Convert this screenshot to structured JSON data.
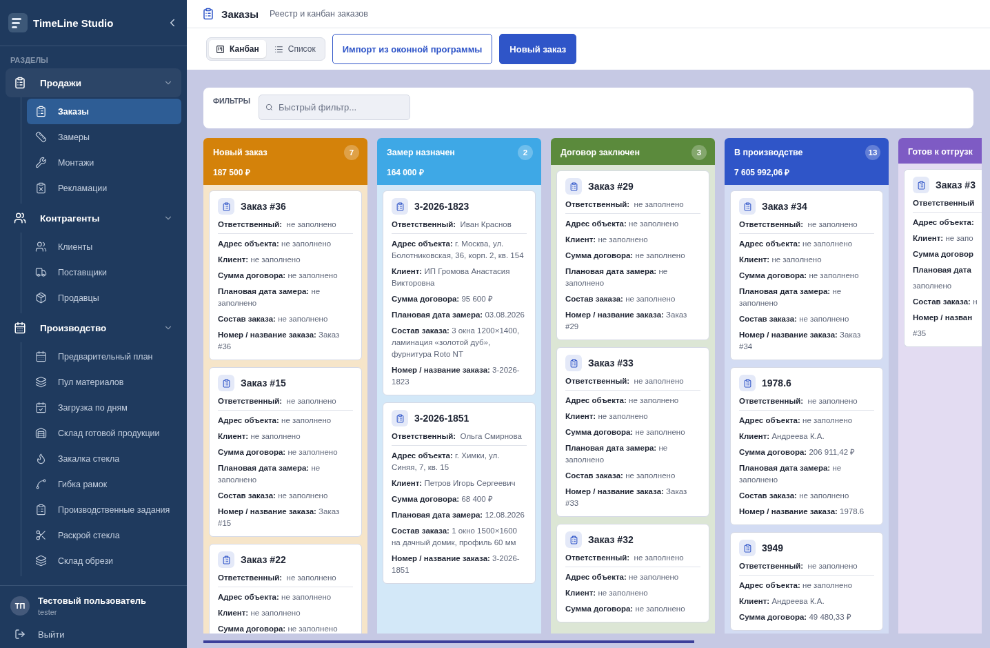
{
  "app": {
    "name": "TimeLine Studio"
  },
  "sidebar": {
    "section_label": "РАЗДЕЛЫ",
    "groups": [
      {
        "label": "Продажи",
        "active": true,
        "expanded": true,
        "items": [
          {
            "label": "Заказы",
            "selected": true
          },
          {
            "label": "Замеры",
            "selected": false
          },
          {
            "label": "Монтажи",
            "selected": false
          },
          {
            "label": "Рекламации",
            "selected": false
          }
        ]
      },
      {
        "label": "Контрагенты",
        "active": false,
        "expanded": true,
        "items": [
          {
            "label": "Клиенты",
            "selected": false
          },
          {
            "label": "Поставщики",
            "selected": false
          },
          {
            "label": "Продавцы",
            "selected": false
          }
        ]
      },
      {
        "label": "Производство",
        "active": false,
        "expanded": true,
        "items": [
          {
            "label": "Предварительный план",
            "selected": false
          },
          {
            "label": "Пул материалов",
            "selected": false
          },
          {
            "label": "Загрузка по дням",
            "selected": false
          },
          {
            "label": "Склад готовой продукции",
            "selected": false
          },
          {
            "label": "Закалка стекла",
            "selected": false
          },
          {
            "label": "Гибка рамок",
            "selected": false
          },
          {
            "label": "Производственные задания",
            "selected": false
          },
          {
            "label": "Раскрой стекла",
            "selected": false
          },
          {
            "label": "Склад обрези",
            "selected": false
          }
        ]
      }
    ]
  },
  "user": {
    "initials": "ТП",
    "name": "Тестовый пользователь",
    "login": "tester"
  },
  "logout": "Выйти",
  "header": {
    "title": "Заказы",
    "subtitle": "Реестр и канбан заказов"
  },
  "view_toggle": [
    {
      "label": "Канбан",
      "selected": true
    },
    {
      "label": "Список",
      "selected": false
    }
  ],
  "buttons": [
    {
      "label": "Импорт из оконной программы",
      "kind": "outline"
    },
    {
      "label": "Новый заказ",
      "kind": "primary"
    }
  ],
  "filters": {
    "label": "ФИЛЬТРЫ",
    "search": {
      "placeholder": "Быстрый фильтр..."
    }
  },
  "columns": [
    {
      "title": "Новый заказ",
      "count": "7",
      "total": "187 500 ₽",
      "color": "#d4820a",
      "clipped": false,
      "cards": [
        {
          "title": "Заказ #36",
          "responsible": {
            "label": "Ответственный:",
            "value": "не заполнено"
          },
          "fields": [
            {
              "label": "Адрес объекта:",
              "value": "не заполнено"
            },
            {
              "label": "Клиент:",
              "value": "не заполнено"
            },
            {
              "label": "Сумма договора:",
              "value": "не заполнено"
            },
            {
              "label": "Плановая дата замера:",
              "value": "не заполнено"
            },
            {
              "label": "Состав заказа:",
              "value": "не заполнено"
            },
            {
              "label": "Номер / название заказа:",
              "value": "Заказ #36"
            }
          ]
        },
        {
          "title": "Заказ #15",
          "responsible": {
            "label": "Ответственный:",
            "value": "не заполнено"
          },
          "fields": [
            {
              "label": "Адрес объекта:",
              "value": "не заполнено"
            },
            {
              "label": "Клиент:",
              "value": "не заполнено"
            },
            {
              "label": "Сумма договора:",
              "value": "не заполнено"
            },
            {
              "label": "Плановая дата замера:",
              "value": "не заполнено"
            },
            {
              "label": "Состав заказа:",
              "value": "не заполнено"
            },
            {
              "label": "Номер / название заказа:",
              "value": "Заказ #15"
            }
          ]
        },
        {
          "title": "Заказ #22",
          "responsible": {
            "label": "Ответственный:",
            "value": "не заполнено"
          },
          "fields": [
            {
              "label": "Адрес объекта:",
              "value": "не заполнено"
            },
            {
              "label": "Клиент:",
              "value": "не заполнено"
            },
            {
              "label": "Сумма договора:",
              "value": "не заполнено"
            }
          ]
        }
      ]
    },
    {
      "title": "Замер назначен",
      "count": "2",
      "total": "164 000 ₽",
      "color": "#3ea8e6",
      "clipped": false,
      "cards": [
        {
          "title": "3-2026-1823",
          "responsible": {
            "label": "Ответственный:",
            "value": "Иван Краснов"
          },
          "fields": [
            {
              "label": "Адрес объекта:",
              "value": "г. Москва, ул. Болотниковская, 36, корп. 2, кв. 154"
            },
            {
              "label": "Клиент:",
              "value": "ИП Громова Анастасия Викторовна"
            },
            {
              "label": "Сумма договора:",
              "value": "95 600 ₽"
            },
            {
              "label": "Плановая дата замера:",
              "value": "03.08.2026"
            },
            {
              "label": "Состав заказа:",
              "value": "3 окна 1200×1400, ламинация «золотой дуб», фурнитура Roto NT"
            },
            {
              "label": "Номер / название заказа:",
              "value": "3-2026-1823"
            }
          ]
        },
        {
          "title": "3-2026-1851",
          "responsible": {
            "label": "Ответственный:",
            "value": "Ольга Смирнова"
          },
          "fields": [
            {
              "label": "Адрес объекта:",
              "value": "г. Химки, ул. Синяя, 7, кв. 15"
            },
            {
              "label": "Клиент:",
              "value": "Петров Игорь Сергеевич"
            },
            {
              "label": "Сумма договора:",
              "value": "68 400 ₽"
            },
            {
              "label": "Плановая дата замера:",
              "value": "12.08.2026"
            },
            {
              "label": "Состав заказа:",
              "value": "1 окно 1500×1600 на дачный домик, профиль 60 мм"
            },
            {
              "label": "Номер / название заказа:",
              "value": "3-2026-1851"
            }
          ]
        }
      ]
    },
    {
      "title": "Договор заключен",
      "count": "3",
      "color": "#5b8a3c",
      "clipped": false,
      "cards": [
        {
          "title": "Заказ #29",
          "responsible": {
            "label": "Ответственный:",
            "value": "не заполнено"
          },
          "fields": [
            {
              "label": "Адрес объекта:",
              "value": "не заполнено"
            },
            {
              "label": "Клиент:",
              "value": "не заполнено"
            },
            {
              "label": "Сумма договора:",
              "value": "не заполнено"
            },
            {
              "label": "Плановая дата замера:",
              "value": "не заполнено"
            },
            {
              "label": "Состав заказа:",
              "value": "не заполнено"
            },
            {
              "label": "Номер / название заказа:",
              "value": "Заказ #29"
            }
          ]
        },
        {
          "title": "Заказ #33",
          "responsible": {
            "label": "Ответственный:",
            "value": "не заполнено"
          },
          "fields": [
            {
              "label": "Адрес объекта:",
              "value": "не заполнено"
            },
            {
              "label": "Клиент:",
              "value": "не заполнено"
            },
            {
              "label": "Сумма договора:",
              "value": "не заполнено"
            },
            {
              "label": "Плановая дата замера:",
              "value": "не заполнено"
            },
            {
              "label": "Состав заказа:",
              "value": "не заполнено"
            },
            {
              "label": "Номер / название заказа:",
              "value": "Заказ #33"
            }
          ]
        },
        {
          "title": "Заказ #32",
          "responsible": {
            "label": "Ответственный:",
            "value": "не заполнено"
          },
          "fields": [
            {
              "label": "Адрес объекта:",
              "value": "не заполнено"
            },
            {
              "label": "Клиент:",
              "value": "не заполнено"
            },
            {
              "label": "Сумма договора:",
              "value": "не заполнено"
            }
          ]
        }
      ]
    },
    {
      "title": "В производстве",
      "count": "13",
      "total": "7 605 992,06 ₽",
      "color": "#2f55c8",
      "clipped": false,
      "cards": [
        {
          "title": "Заказ #34",
          "responsible": {
            "label": "Ответственный:",
            "value": "не заполнено"
          },
          "fields": [
            {
              "label": "Адрес объекта:",
              "value": "не заполнено"
            },
            {
              "label": "Клиент:",
              "value": "не заполнено"
            },
            {
              "label": "Сумма договора:",
              "value": "не заполнено"
            },
            {
              "label": "Плановая дата замера:",
              "value": "не заполнено"
            },
            {
              "label": "Состав заказа:",
              "value": "не заполнено"
            },
            {
              "label": "Номер / название заказа:",
              "value": "Заказ #34"
            }
          ]
        },
        {
          "title": "1978.6",
          "responsible": {
            "label": "Ответственный:",
            "value": "не заполнено"
          },
          "fields": [
            {
              "label": "Адрес объекта:",
              "value": "не заполнено"
            },
            {
              "label": "Клиент:",
              "value": "Андреева К.А."
            },
            {
              "label": "Сумма договора:",
              "value": "206 911,42 ₽"
            },
            {
              "label": "Плановая дата замера:",
              "value": "не заполнено"
            },
            {
              "label": "Состав заказа:",
              "value": "не заполнено"
            },
            {
              "label": "Номер / название заказа:",
              "value": "1978.6"
            }
          ]
        },
        {
          "title": "3949",
          "responsible": {
            "label": "Ответственный:",
            "value": "не заполнено"
          },
          "fields": [
            {
              "label": "Адрес объекта:",
              "value": "не заполнено"
            },
            {
              "label": "Клиент:",
              "value": "Андреева К.А."
            },
            {
              "label": "Сумма договора:",
              "value": "49 480,33 ₽"
            }
          ]
        }
      ]
    },
    {
      "title": "Готов к отгрузк",
      "color": "#7e5bc4",
      "clipped": true,
      "cards": [
        {
          "title": "Заказ #3",
          "responsible": {
            "label": "Ответственный"
          },
          "fields": [
            {
              "label": "Адрес объекта:"
            },
            {
              "label": "Клиент:",
              "value": "не запо"
            },
            {
              "label": "Сумма договор"
            },
            {
              "label": "Плановая дата"
            },
            {
              "value": "заполнено"
            },
            {
              "label": "Состав заказа:",
              "value": "н"
            },
            {
              "label": "Номер / назван"
            },
            {
              "value": "#35"
            }
          ]
        }
      ]
    }
  ]
}
